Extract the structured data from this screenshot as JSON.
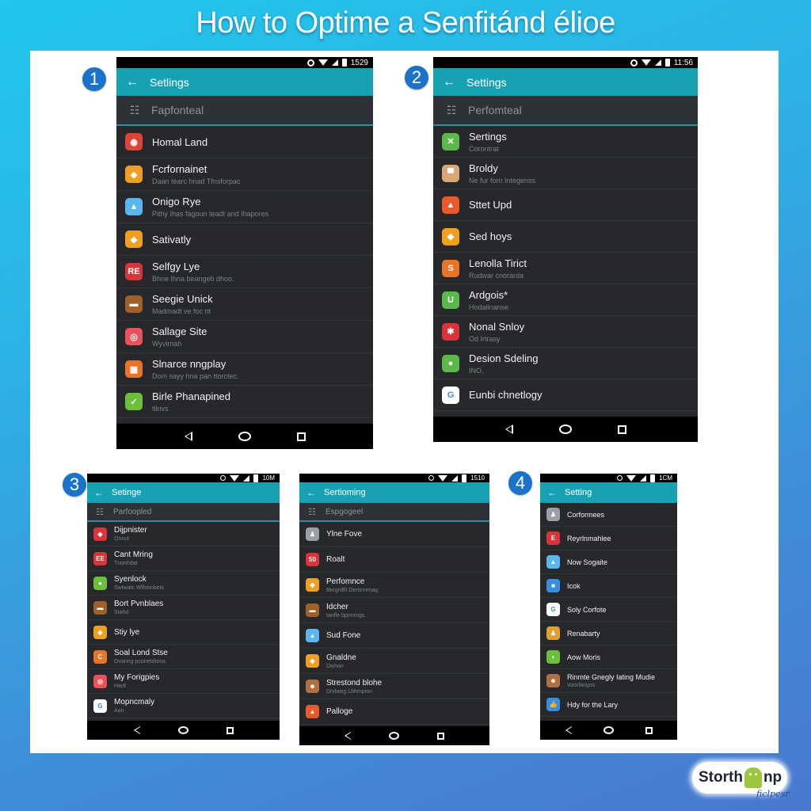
{
  "title": "How to Optime a Senfitánd élioe",
  "badges": [
    "1",
    "2",
    "3",
    "4"
  ],
  "colors": {
    "appbar": "#17a2b4",
    "badge": "#1a73c8",
    "screen_bg": "#26282c",
    "background_top": "#22c6ea",
    "background_bottom": "#4a78cf"
  },
  "phones": [
    {
      "status_time": "1529",
      "appbar_title": "Setlings",
      "section": {
        "label": "Fapfonteal",
        "icon": "trophy-icon"
      },
      "rows": [
        {
          "title": "Homal Land",
          "subtitle": "",
          "icon": "chrome-icon",
          "color": "#db4437",
          "glyph": "◉"
        },
        {
          "title": "Fcrfornainet",
          "subtitle": "Daan tearc hnad Tfnsforpac",
          "icon": "puzzle-icon",
          "color": "#f0a020",
          "glyph": "◆"
        },
        {
          "title": "Onigo Rye",
          "subtitle": "Pithy Ihas fagoun teadt and Ihapores",
          "icon": "water-drop-icon",
          "color": "#5ab6ec",
          "glyph": "▲"
        },
        {
          "title": "Sativatly",
          "subtitle": "",
          "icon": "puzzle-icon",
          "color": "#f0a020",
          "glyph": "◆"
        },
        {
          "title": "Selfgy Lye",
          "subtitle": "Bhne Ihna beangeb dhoo.",
          "icon": "re-app-icon",
          "color": "#d9343a",
          "glyph": "RE"
        },
        {
          "title": "Seegie Unick",
          "subtitle": "Madmadt ve foc rit",
          "icon": "chest-icon",
          "color": "#a0602a",
          "glyph": "▬"
        },
        {
          "title": "Sallage Site",
          "subtitle": "Wyvirnah",
          "icon": "pink-app-icon",
          "color": "#e8525a",
          "glyph": "◎"
        },
        {
          "title": "Slnarce nngplay",
          "subtitle": "Dom sayy hna pan ttorctec.",
          "icon": "grid-app-icon",
          "color": "#e8742a",
          "glyph": "▦"
        },
        {
          "title": "Birle Phanapined",
          "subtitle": "tlinvs",
          "icon": "shield-app-icon",
          "color": "#6cbf3c",
          "glyph": "✓"
        }
      ]
    },
    {
      "status_time": "11:56",
      "appbar_title": "Settings",
      "section": {
        "label": "Perfomteal",
        "icon": "tune-icon"
      },
      "rows": [
        {
          "title": "Sertings",
          "subtitle": "Corontrat",
          "icon": "tools-icon",
          "color": "#5cb84a",
          "glyph": "✕"
        },
        {
          "title": "Broldy",
          "subtitle": "Ne fur forn Integenss",
          "icon": "bag-icon",
          "color": "#d9a878",
          "glyph": "▀"
        },
        {
          "title": "Sttet Upd",
          "subtitle": "",
          "icon": "warning-cone-icon",
          "color": "#e85a2a",
          "glyph": "▲"
        },
        {
          "title": "Sed hoys",
          "subtitle": "",
          "icon": "puzzle-icon",
          "color": "#f0a020",
          "glyph": "◆"
        },
        {
          "title": "Lenolla Tirict",
          "subtitle": "Rudwar cnorarda",
          "icon": "orange-app-icon",
          "color": "#e8742a",
          "glyph": "S"
        },
        {
          "title": "Ardgois*",
          "subtitle": "Hodalinanse",
          "icon": "green-app-icon",
          "color": "#5cb84a",
          "glyph": "U"
        },
        {
          "title": "Nonal Snloy",
          "subtitle": "Od Irtrasy",
          "icon": "red-app-icon",
          "color": "#d9343a",
          "glyph": "✱"
        },
        {
          "title": "Desion Sdeling",
          "subtitle": "INO,",
          "icon": "chat-app-icon",
          "color": "#5cb84a",
          "glyph": "●"
        },
        {
          "title": "Eunbi chnetlogy",
          "subtitle": "",
          "icon": "google-icon",
          "color": "#ffffff",
          "glyph": "G"
        }
      ]
    },
    {
      "status_time": "10M",
      "appbar_title": "Setinge",
      "section": {
        "label": "Parfoopled",
        "icon": "tune-icon"
      },
      "rows": [
        {
          "title": "Dijpnister",
          "subtitle": "Onnut",
          "icon": "red-app-icon",
          "color": "#d9343a",
          "glyph": "◈"
        },
        {
          "title": "Cant Mring",
          "subtitle": "Tnonhdat",
          "icon": "re-app-icon",
          "color": "#d9343a",
          "glyph": "EE"
        },
        {
          "title": "Syenlock",
          "subtitle": "Swtwatc Wfheinbets",
          "icon": "green-app-icon",
          "color": "#6cbf3c",
          "glyph": "●"
        },
        {
          "title": "Bort Pvnblaes",
          "subtitle": "Stahd",
          "icon": "chest-icon",
          "color": "#a0602a",
          "glyph": "▬"
        },
        {
          "title": "Stiy lye",
          "subtitle": "",
          "icon": "puzzle-icon",
          "color": "#f0a020",
          "glyph": "◆"
        },
        {
          "title": "Soal Lond Stse",
          "subtitle": "Ovanng pconetdtosa",
          "icon": "orange-app-icon",
          "color": "#e8742a",
          "glyph": "C"
        },
        {
          "title": "My Forigpies",
          "subtitle": "Haof",
          "icon": "pink-app-icon",
          "color": "#e8525a",
          "glyph": "◎"
        },
        {
          "title": "Mopncmaly",
          "subtitle": "Aan",
          "icon": "google-icon",
          "color": "#ffffff",
          "glyph": "G"
        }
      ]
    },
    {
      "status_time": "1510",
      "appbar_title": "Sertioming",
      "section": {
        "label": "Espgogeel",
        "icon": "tune-icon"
      },
      "rows": [
        {
          "title": "Ylne Fove",
          "subtitle": "",
          "icon": "person-icon",
          "color": "#9aa0a6",
          "glyph": "♟"
        },
        {
          "title": "Roalt",
          "subtitle": "",
          "icon": "re-app-icon",
          "color": "#d9343a",
          "glyph": "50"
        },
        {
          "title": "Perfomnce",
          "subtitle": "Bergrdfit Demnrenag",
          "icon": "puzzle-icon",
          "color": "#f0a020",
          "glyph": "◆"
        },
        {
          "title": "Idcher",
          "subtitle": "Ianfle bpnnrngs.",
          "icon": "chest-icon",
          "color": "#a0602a",
          "glyph": "▬"
        },
        {
          "title": "Sud Fone",
          "subtitle": "",
          "icon": "water-drop-icon",
          "color": "#5ab6ec",
          "glyph": "▲"
        },
        {
          "title": "Gnaldne",
          "subtitle": "Dwhon",
          "icon": "puzzle-icon",
          "color": "#f0a020",
          "glyph": "◆"
        },
        {
          "title": "Strestond blohe",
          "subtitle": "Dnitwog Lbhmpion",
          "icon": "lion-icon",
          "color": "#b07040",
          "glyph": "☻"
        },
        {
          "title": "Palloge",
          "subtitle": "",
          "icon": "warning-cone-icon",
          "color": "#e85a2a",
          "glyph": "▲"
        }
      ]
    },
    {
      "status_time": "1CM",
      "appbar_title": "Setting",
      "section": null,
      "rows": [
        {
          "title": "Corformees",
          "subtitle": "",
          "icon": "person-icon",
          "color": "#9aa0a6",
          "glyph": "♟"
        },
        {
          "title": "Reyrlnmahlee",
          "subtitle": "",
          "icon": "re-app-icon",
          "color": "#d9343a",
          "glyph": "E"
        },
        {
          "title": "Now Sogaite",
          "subtitle": "",
          "icon": "water-drop-icon",
          "color": "#5ab6ec",
          "glyph": "▲"
        },
        {
          "title": "Icok",
          "subtitle": "",
          "icon": "blue-app-icon",
          "color": "#3a8ee0",
          "glyph": "■"
        },
        {
          "title": "Soly Corfote",
          "subtitle": "",
          "icon": "google-icon",
          "color": "#ffffff",
          "glyph": "G"
        },
        {
          "title": "Renabarty",
          "subtitle": "",
          "icon": "person-icon",
          "color": "#e0a030",
          "glyph": "♟"
        },
        {
          "title": "Aow Moris",
          "subtitle": "",
          "icon": "leaf-icon",
          "color": "#6cbf3c",
          "glyph": "◗"
        },
        {
          "title": "Rinmte Gnegly Iating Mudie",
          "subtitle": "Voorfangos",
          "icon": "lion-icon",
          "color": "#b07040",
          "glyph": "☻"
        },
        {
          "title": "Hdy for the Lary",
          "subtitle": "",
          "icon": "blue-app-icon",
          "color": "#3a8ee0",
          "glyph": "👍"
        }
      ]
    }
  ],
  "logo": {
    "text_left": "Storth",
    "text_right": "np",
    "subtitle": "ficlpesr",
    "icon": "android-icon"
  }
}
